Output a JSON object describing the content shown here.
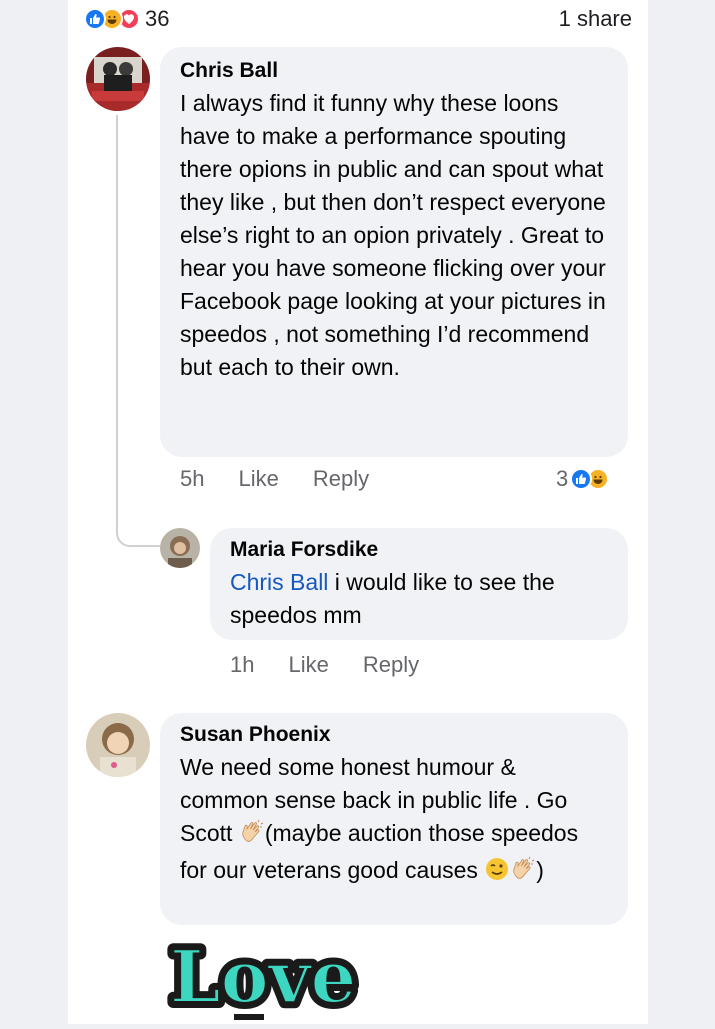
{
  "header": {
    "reaction_count": "36",
    "share_count": "1 share",
    "reaction_icons": [
      "like-icon",
      "haha-icon",
      "love-icon"
    ]
  },
  "comments": [
    {
      "author": "Chris Ball",
      "text": "I always find it funny why these loons have to make a performance spouting there opions in public and can spout what they like , but then don’t respect everyone else’s right to an opion privately . Great to hear you have someone flicking over your Facebook page looking at your pictures in speedos , not something I’d recommend but each to their own.",
      "time": "5h",
      "like_label": "Like",
      "reply_label": "Reply",
      "reaction_count": "3"
    },
    {
      "author": "Maria Forsdike",
      "mention": "Chris Ball",
      "text": " i would like to see the speedos mm",
      "time": "1h",
      "like_label": "Like",
      "reply_label": "Reply"
    },
    {
      "author": "Susan Phoenix",
      "text_part1": "We need some honest humour & common sense back in public life . Go Scott ",
      "text_part2": "(maybe auction those speedos for our veterans good causes ",
      "text_part3": ")"
    }
  ],
  "sticker": {
    "text": "Love"
  },
  "colors": {
    "like_blue": "#1877f2",
    "haha_yellow": "#f7b125",
    "love_red": "#f33e58",
    "bubble_bg": "#f0f2f5",
    "mention_blue": "#1558c0",
    "sticker_teal": "#3dd6c0"
  }
}
